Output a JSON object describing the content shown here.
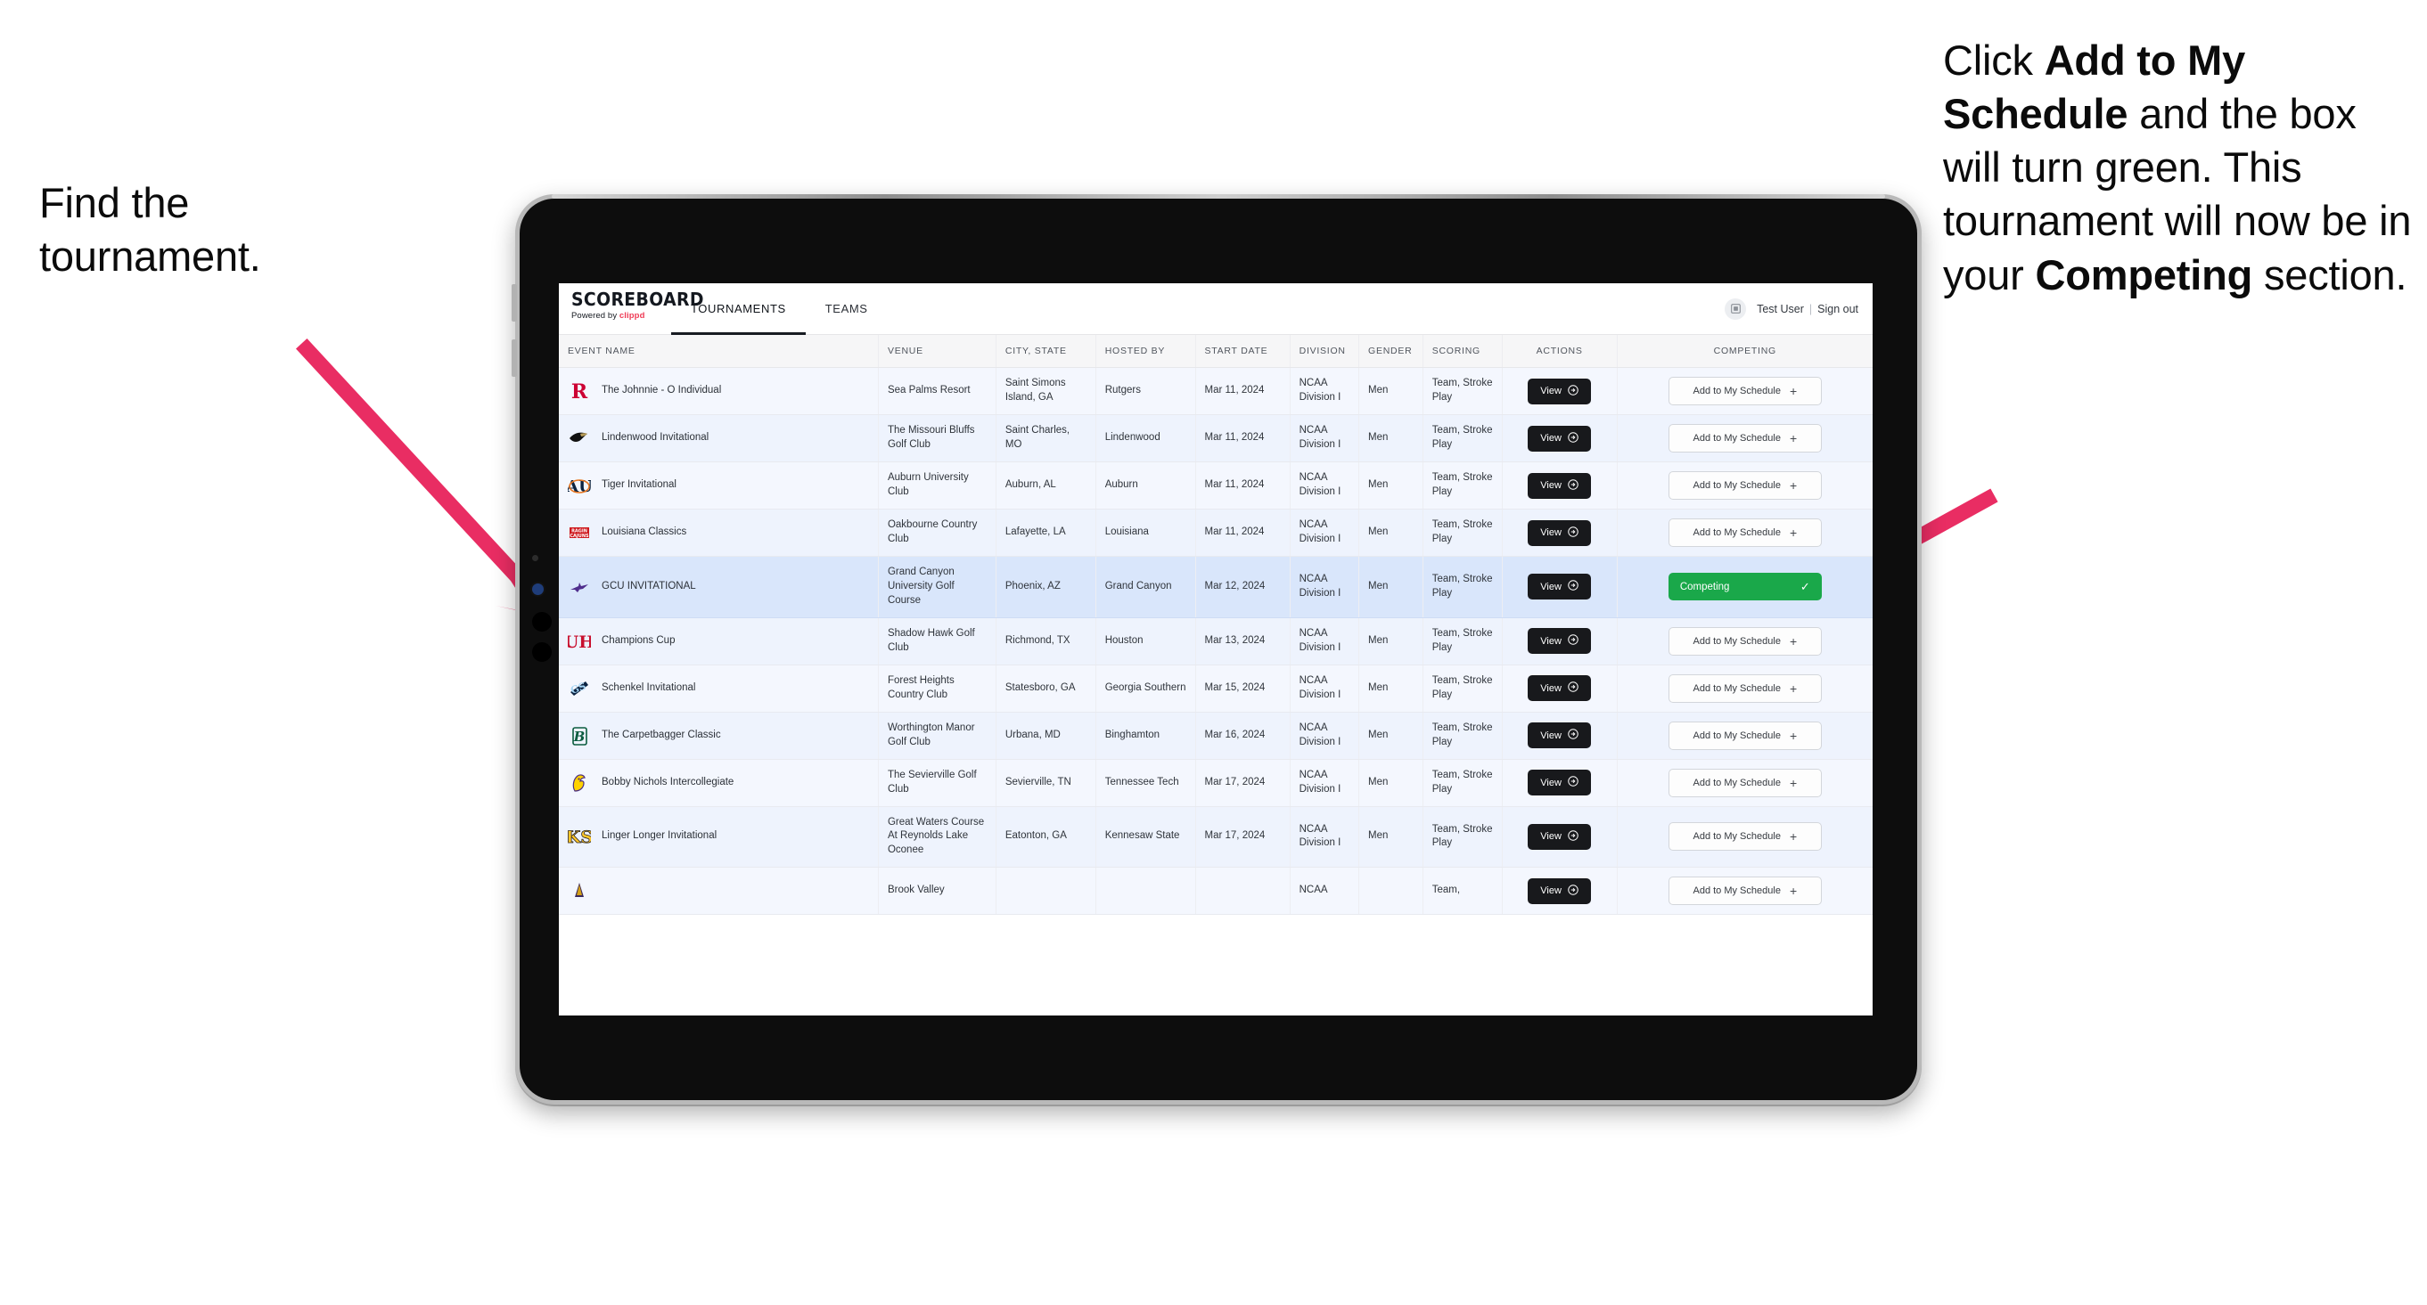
{
  "annotations": {
    "left": {
      "line1": "Find the",
      "line2": "tournament."
    },
    "right": {
      "p1_a": "Click ",
      "p1_b": "Add to My Schedule",
      "p1_c": " and the box will turn green. This tournament will now be in your ",
      "p1_d": "Competing",
      "p1_e": " section."
    }
  },
  "app": {
    "brand": {
      "title": "SCOREBOARD",
      "powered_prefix": "Powered by ",
      "powered_name": "clippd"
    },
    "nav": {
      "tabs": [
        {
          "label": "TOURNAMENTS",
          "active": true
        },
        {
          "label": "TEAMS",
          "active": false
        }
      ]
    },
    "user": {
      "name": "Test User",
      "separator": "|",
      "signout": "Sign out"
    },
    "table": {
      "columns": [
        "EVENT NAME",
        "VENUE",
        "CITY, STATE",
        "HOSTED BY",
        "START DATE",
        "DIVISION",
        "GENDER",
        "SCORING",
        "ACTIONS",
        "COMPETING"
      ],
      "action_label": "View",
      "add_label": "Add to My Schedule",
      "add_glyph": "+",
      "competing_label": "Competing",
      "competing_glyph": "✓",
      "competing_color": "#1aa84a",
      "rows": [
        {
          "event": "The Johnnie - O Individual",
          "venue": "Sea Palms Resort",
          "city": "Saint Simons Island, GA",
          "hosted_by": "Rutgers",
          "start_date": "Mar 11, 2024",
          "division": "NCAA Division I",
          "gender": "Men",
          "scoring": "Team, Stroke Play",
          "competing": false,
          "logo": "rutgers-logo"
        },
        {
          "event": "Lindenwood Invitational",
          "venue": "The Missouri Bluffs Golf Club",
          "city": "Saint Charles, MO",
          "hosted_by": "Lindenwood",
          "start_date": "Mar 11, 2024",
          "division": "NCAA Division I",
          "gender": "Men",
          "scoring": "Team, Stroke Play",
          "competing": false,
          "logo": "lindenwood-logo"
        },
        {
          "event": "Tiger Invitational",
          "venue": "Auburn University Club",
          "city": "Auburn, AL",
          "hosted_by": "Auburn",
          "start_date": "Mar 11, 2024",
          "division": "NCAA Division I",
          "gender": "Men",
          "scoring": "Team, Stroke Play",
          "competing": false,
          "logo": "auburn-logo"
        },
        {
          "event": "Louisiana Classics",
          "venue": "Oakbourne Country Club",
          "city": "Lafayette, LA",
          "hosted_by": "Louisiana",
          "start_date": "Mar 11, 2024",
          "division": "NCAA Division I",
          "gender": "Men",
          "scoring": "Team, Stroke Play",
          "competing": false,
          "logo": "louisiana-logo"
        },
        {
          "event": "GCU INVITATIONAL",
          "venue": "Grand Canyon University Golf Course",
          "city": "Phoenix, AZ",
          "hosted_by": "Grand Canyon",
          "start_date": "Mar 12, 2024",
          "division": "NCAA Division I",
          "gender": "Men",
          "scoring": "Team, Stroke Play",
          "competing": true,
          "logo": "grand-canyon-logo"
        },
        {
          "event": "Champions Cup",
          "venue": "Shadow Hawk Golf Club",
          "city": "Richmond, TX",
          "hosted_by": "Houston",
          "start_date": "Mar 13, 2024",
          "division": "NCAA Division I",
          "gender": "Men",
          "scoring": "Team, Stroke Play",
          "competing": false,
          "logo": "houston-logo"
        },
        {
          "event": "Schenkel Invitational",
          "venue": "Forest Heights Country Club",
          "city": "Statesboro, GA",
          "hosted_by": "Georgia Southern",
          "start_date": "Mar 15, 2024",
          "division": "NCAA Division I",
          "gender": "Men",
          "scoring": "Team, Stroke Play",
          "competing": false,
          "logo": "georgia-southern-logo"
        },
        {
          "event": "The Carpetbagger Classic",
          "venue": "Worthington Manor Golf Club",
          "city": "Urbana, MD",
          "hosted_by": "Binghamton",
          "start_date": "Mar 16, 2024",
          "division": "NCAA Division I",
          "gender": "Men",
          "scoring": "Team, Stroke Play",
          "competing": false,
          "logo": "binghamton-logo"
        },
        {
          "event": "Bobby Nichols Intercollegiate",
          "venue": "The Sevierville Golf Club",
          "city": "Sevierville, TN",
          "hosted_by": "Tennessee Tech",
          "start_date": "Mar 17, 2024",
          "division": "NCAA Division I",
          "gender": "Men",
          "scoring": "Team, Stroke Play",
          "competing": false,
          "logo": "tennessee-tech-logo"
        },
        {
          "event": "Linger Longer Invitational",
          "venue": "Great Waters Course At Reynolds Lake Oconee",
          "city": "Eatonton, GA",
          "hosted_by": "Kennesaw State",
          "start_date": "Mar 17, 2024",
          "division": "NCAA Division I",
          "gender": "Men",
          "scoring": "Team, Stroke Play",
          "competing": false,
          "logo": "kennesaw-state-logo"
        },
        {
          "event": "",
          "venue": "Brook Valley",
          "city": "",
          "hosted_by": "",
          "start_date": "",
          "division": "NCAA",
          "gender": "",
          "scoring": "Team,",
          "competing": false,
          "logo": "partial-logo"
        }
      ]
    }
  },
  "colors": {
    "arrow": "#e92d63",
    "accent": "#ef3b55",
    "selected_row": "#d9e6fb"
  }
}
